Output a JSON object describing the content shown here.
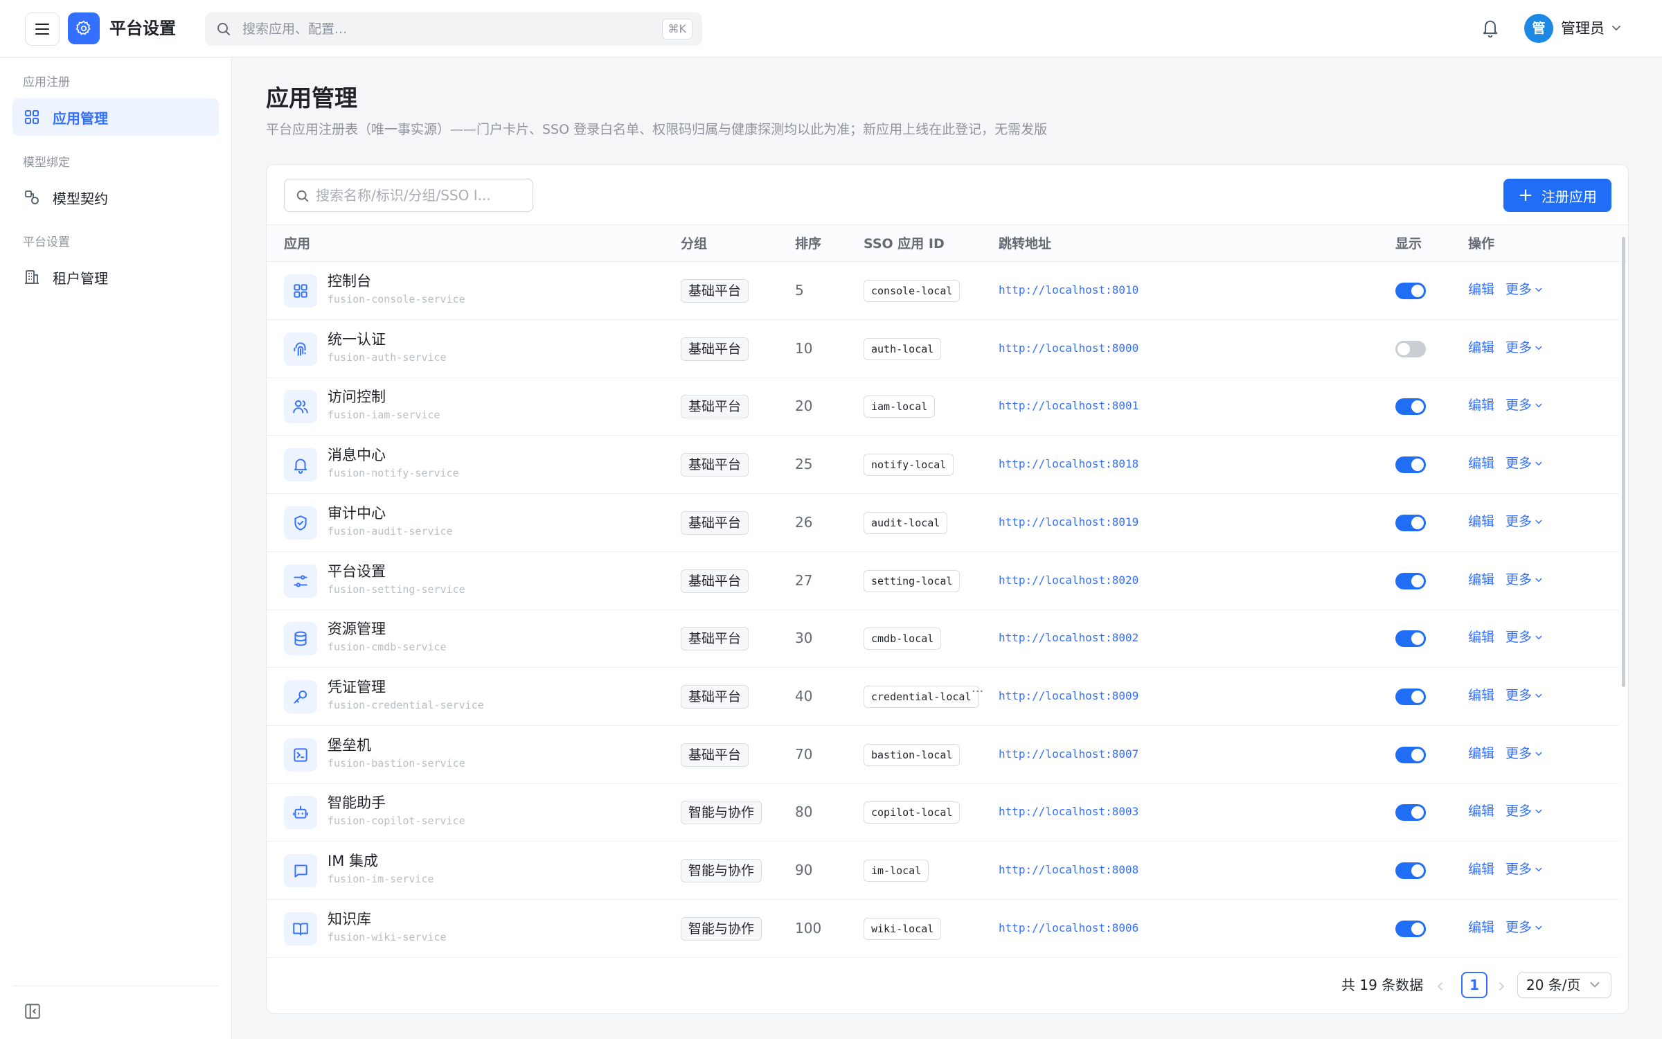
{
  "topbar": {
    "app_title": "平台设置",
    "search_placeholder": "搜索应用、配置...",
    "search_shortcut": "⌘K",
    "user_avatar_text": "管",
    "user_name": "管理员"
  },
  "sidebar": {
    "groups": [
      {
        "label": "应用注册",
        "items": [
          {
            "label": "应用管理",
            "icon": "grid-icon",
            "active": true
          }
        ]
      },
      {
        "label": "模型绑定",
        "items": [
          {
            "label": "模型契约",
            "icon": "shapes-icon",
            "active": false
          }
        ]
      },
      {
        "label": "平台设置",
        "items": [
          {
            "label": "租户管理",
            "icon": "building-icon",
            "active": false
          }
        ]
      }
    ]
  },
  "page": {
    "title": "应用管理",
    "description": "平台应用注册表（唯一事实源）——门户卡片、SSO 登录白名单、权限码归属与健康探测均以此为准；新应用上线在此登记，无需发版"
  },
  "table": {
    "search_placeholder": "搜索名称/标识/分组/SSO I...",
    "register_button": "注册应用",
    "columns": [
      "应用",
      "分组",
      "排序",
      "SSO 应用 ID",
      "跳转地址",
      "显示",
      "操作"
    ],
    "rows": [
      {
        "icon": "grid-icon",
        "name": "控制台",
        "code": "fusion-console-service",
        "group": "基础平台",
        "order": "5",
        "sso": "console-local",
        "url": "http://localhost:8010",
        "visible": true,
        "edit": "编辑",
        "more": "更多"
      },
      {
        "icon": "fingerprint-icon",
        "name": "统一认证",
        "code": "fusion-auth-service",
        "group": "基础平台",
        "order": "10",
        "sso": "auth-local",
        "url": "http://localhost:8000",
        "visible": false,
        "edit": "编辑",
        "more": "更多"
      },
      {
        "icon": "users-icon",
        "name": "访问控制",
        "code": "fusion-iam-service",
        "group": "基础平台",
        "order": "20",
        "sso": "iam-local",
        "url": "http://localhost:8001",
        "visible": true,
        "edit": "编辑",
        "more": "更多"
      },
      {
        "icon": "bell-icon",
        "name": "消息中心",
        "code": "fusion-notify-service",
        "group": "基础平台",
        "order": "25",
        "sso": "notify-local",
        "url": "http://localhost:8018",
        "visible": true,
        "edit": "编辑",
        "more": "更多"
      },
      {
        "icon": "shield-check-icon",
        "name": "审计中心",
        "code": "fusion-audit-service",
        "group": "基础平台",
        "order": "26",
        "sso": "audit-local",
        "url": "http://localhost:8019",
        "visible": true,
        "edit": "编辑",
        "more": "更多"
      },
      {
        "icon": "sliders-icon",
        "name": "平台设置",
        "code": "fusion-setting-service",
        "group": "基础平台",
        "order": "27",
        "sso": "setting-local",
        "url": "http://localhost:8020",
        "visible": true,
        "edit": "编辑",
        "more": "更多"
      },
      {
        "icon": "database-icon",
        "name": "资源管理",
        "code": "fusion-cmdb-service",
        "group": "基础平台",
        "order": "30",
        "sso": "cmdb-local",
        "url": "http://localhost:8002",
        "visible": true,
        "edit": "编辑",
        "more": "更多"
      },
      {
        "icon": "key-icon",
        "name": "凭证管理",
        "code": "fusion-credential-service",
        "group": "基础平台",
        "order": "40",
        "sso": "credential-local",
        "sso_truncated": true,
        "url": "http://localhost:8009",
        "visible": true,
        "edit": "编辑",
        "more": "更多"
      },
      {
        "icon": "terminal-icon",
        "name": "堡垒机",
        "code": "fusion-bastion-service",
        "group": "基础平台",
        "order": "70",
        "sso": "bastion-local",
        "url": "http://localhost:8007",
        "visible": true,
        "edit": "编辑",
        "more": "更多"
      },
      {
        "icon": "bot-icon",
        "name": "智能助手",
        "code": "fusion-copilot-service",
        "group": "智能与协作",
        "order": "80",
        "sso": "copilot-local",
        "url": "http://localhost:8003",
        "visible": true,
        "edit": "编辑",
        "more": "更多"
      },
      {
        "icon": "message-icon",
        "name": "IM 集成",
        "code": "fusion-im-service",
        "group": "智能与协作",
        "order": "90",
        "sso": "im-local",
        "url": "http://localhost:8008",
        "visible": true,
        "edit": "编辑",
        "more": "更多"
      },
      {
        "icon": "book-icon",
        "name": "知识库",
        "code": "fusion-wiki-service",
        "group": "智能与协作",
        "order": "100",
        "sso": "wiki-local",
        "url": "http://localhost:8006",
        "visible": true,
        "edit": "编辑",
        "more": "更多"
      }
    ]
  },
  "pagination": {
    "total_text": "共 19 条数据",
    "current_page": "1",
    "page_size": "20 条/页"
  },
  "colors": {
    "accent": "#3370ff",
    "primary_button": "#1f6ef5",
    "toggle_off": "#c9cdd4"
  }
}
